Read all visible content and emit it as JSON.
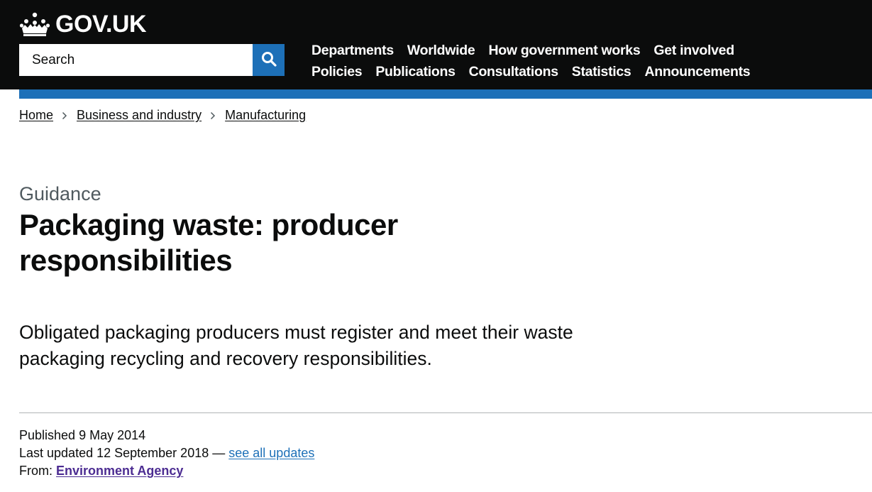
{
  "header": {
    "logo_text": "GOV.UK",
    "logo_icon": "crown-icon",
    "search": {
      "placeholder": "Search",
      "button_icon": "search-icon"
    },
    "nav_row1": [
      "Departments",
      "Worldwide",
      "How government works",
      "Get involved"
    ],
    "nav_row2": [
      "Policies",
      "Publications",
      "Consultations",
      "Statistics",
      "Announcements"
    ],
    "colors": {
      "header_bg": "#0b0c0c",
      "stripe": "#1d70b8",
      "search_button": "#1d70b8"
    }
  },
  "breadcrumb": {
    "items": [
      "Home",
      "Business and industry",
      "Manufacturing"
    ],
    "separator_icon": "chevron-right-icon"
  },
  "main": {
    "caption": "Guidance",
    "title": "Packaging waste: producer responsibilities",
    "lead": "Obligated packaging producers must register and meet their waste packaging recycling and recovery responsibilities."
  },
  "metadata": {
    "published_label": "Published",
    "published_date": "9 May 2014",
    "updated_label": "Last updated",
    "updated_date": "12 September 2018",
    "updated_separator": "—",
    "updates_link": "see all updates",
    "from_label": "From:",
    "organisation": "Environment Agency",
    "colors": {
      "link": "#1d70b8",
      "org_link": "#4c2c92"
    }
  }
}
